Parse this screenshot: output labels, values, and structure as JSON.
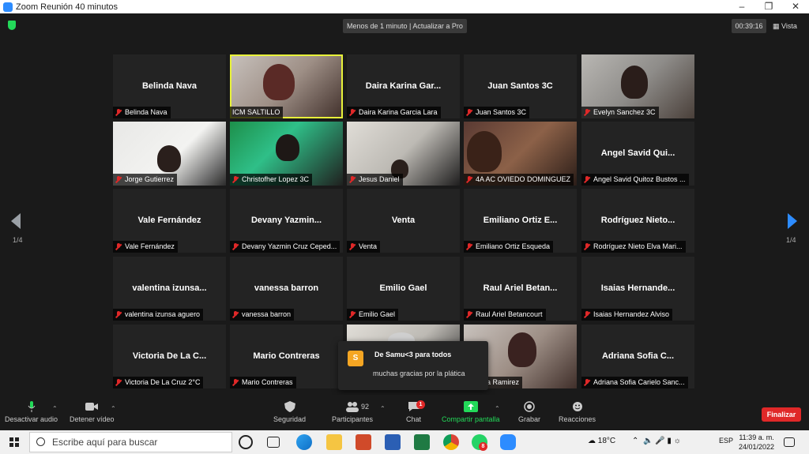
{
  "window": {
    "title": "Zoom Reunión 40 minutos"
  },
  "topbar": {
    "banner": "Menos de 1 minuto | Actualizar a Pro",
    "timer": "00:39:16",
    "view_label": "Vista"
  },
  "pager": {
    "left": "1/4",
    "right": "1/4"
  },
  "tiles": [
    {
      "big": "Belinda Nava",
      "label": "Belinda Nava"
    },
    {
      "big": "",
      "label": "ICM SALTILLO"
    },
    {
      "big": "Daira Karina Gar...",
      "label": "Daira Karina Garcia Lara"
    },
    {
      "big": "Juan Santos 3C",
      "label": "Juan Santos 3C"
    },
    {
      "big": "",
      "label": "Evelyn Sanchez 3C"
    },
    {
      "big": "",
      "label": "Jorge Gutierrez"
    },
    {
      "big": "",
      "label": "Christofher Lopez  3C"
    },
    {
      "big": "",
      "label": "Jesus Daniel"
    },
    {
      "big": "",
      "label": "4A AC OVIEDO DOMINGUEZ"
    },
    {
      "big": "Angel Savid Qui...",
      "label": "Angel Savid Quitoz Bustos ..."
    },
    {
      "big": "Vale Fernández",
      "label": "Vale Fernández"
    },
    {
      "big": "Devany  Yazmin...",
      "label": "Devany Yazmin Cruz Ceped..."
    },
    {
      "big": "Venta",
      "label": "Venta"
    },
    {
      "big": "Emiliano Ortiz E...",
      "label": "Emiliano Ortiz Esqueda"
    },
    {
      "big": "Rodríguez  Nieto...",
      "label": "Rodríguez Nieto Elva Mari..."
    },
    {
      "big": "valentina  izunsa...",
      "label": "valentina izunsa aguero"
    },
    {
      "big": "vanessa barron",
      "label": "vanessa barron"
    },
    {
      "big": "Emilio Gael",
      "label": "Emilio Gael"
    },
    {
      "big": "Raul Ariel Betan...",
      "label": "Raul Ariel Betancourt"
    },
    {
      "big": "Isaias  Hernande...",
      "label": "Isaias Hernandez Alviso"
    },
    {
      "big": "Victoria De La C...",
      "label": "Victoria De La Cruz 2°C"
    },
    {
      "big": "Mario Contreras",
      "label": "Mario Contreras"
    },
    {
      "big": "",
      "label": ""
    },
    {
      "big": "",
      "label": "l Garcia Ramirez"
    },
    {
      "big": "Adriana Sofia C...",
      "label": "Adriana Sofia Carielo Sanc..."
    }
  ],
  "chat_popup": {
    "avatar": "S",
    "from": "De Samu<3 para todos",
    "message": "muchas gracias por la plática"
  },
  "toolbar": {
    "audio": "Desactivar audio",
    "video": "Detener vídeo",
    "security": "Seguridad",
    "participants": "Participantes",
    "participants_count": "92",
    "chat": "Chat",
    "chat_badge": "1",
    "share": "Compartir pantalla",
    "record": "Grabar",
    "reactions": "Reacciones",
    "end": "Finalizar"
  },
  "taskbar": {
    "search_placeholder": "Escribe aquí para buscar",
    "weather": "18°C",
    "language": "ESP",
    "time": "11:39 a. m.",
    "date": "24/01/2022",
    "whatsapp_badge": "8"
  },
  "colors": {
    "accent_blue": "#2d8cff",
    "active_speaker": "#e8f23a",
    "end_red": "#e02828",
    "share_green": "#23d959"
  }
}
